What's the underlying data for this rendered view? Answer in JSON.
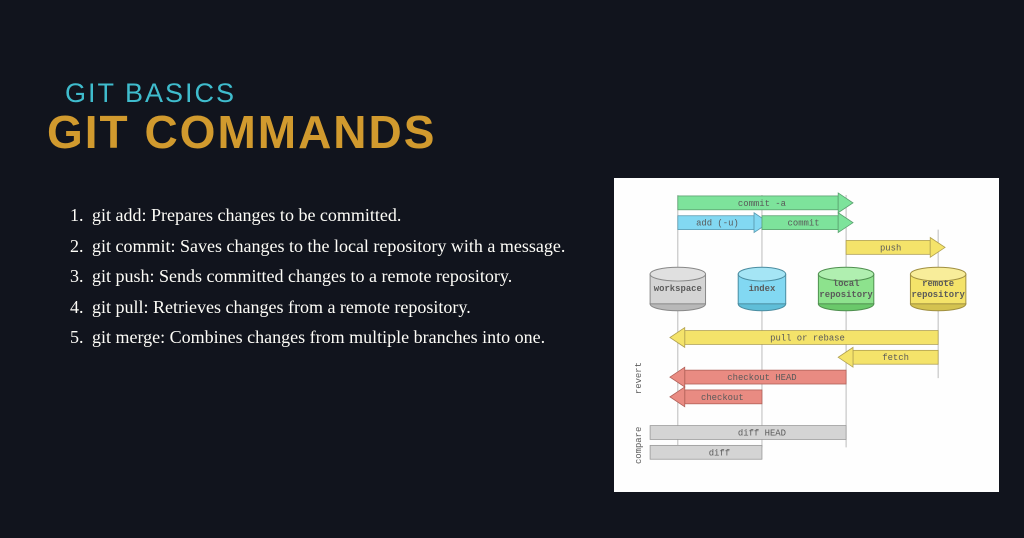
{
  "header": {
    "subtitle": "GIT BASICS",
    "title": "GIT COMMANDS"
  },
  "commands": [
    "git add: Prepares changes to be committed.",
    "git commit: Saves changes to the local repository with a message.",
    "git push: Sends committed changes to a remote repository.",
    "git pull: Retrieves changes from a remote repository.",
    "git merge: Combines changes from multiple branches into one."
  ],
  "diagram": {
    "stages": [
      {
        "name": "workspace",
        "color": "#cccccc"
      },
      {
        "name": "index",
        "color": "#82d8f2"
      },
      {
        "name": "local repository",
        "color": "#8de28d"
      },
      {
        "name": "remote repository",
        "color": "#f4e36a"
      }
    ],
    "arrows_top": [
      {
        "label": "commit -a",
        "from": 0,
        "to": 2,
        "color": "#7de39b"
      },
      {
        "label": "add (-u)",
        "from": 0,
        "to": 1,
        "color": "#82d8f2"
      },
      {
        "label": "commit",
        "from": 1,
        "to": 2,
        "color": "#7de39b"
      },
      {
        "label": "push",
        "from": 2,
        "to": 3,
        "color": "#f4e36a"
      }
    ],
    "arrows_bottom": [
      {
        "label": "pull or rebase",
        "from": 3,
        "to": 0,
        "color": "#f4e36a"
      },
      {
        "label": "fetch",
        "from": 3,
        "to": 2,
        "color": "#f4e36a"
      },
      {
        "label": "checkout HEAD",
        "from": 2,
        "to": 0,
        "color": "#e98b82"
      },
      {
        "label": "checkout",
        "from": 1,
        "to": 0,
        "color": "#e98b82"
      }
    ],
    "side_labels": {
      "revert": "revert",
      "compare": "compare"
    },
    "compare_rows": [
      {
        "label": "diff HEAD",
        "from": 0,
        "to": 2,
        "color": "#cccccc"
      },
      {
        "label": "diff",
        "from": 0,
        "to": 1,
        "color": "#cccccc"
      }
    ]
  }
}
